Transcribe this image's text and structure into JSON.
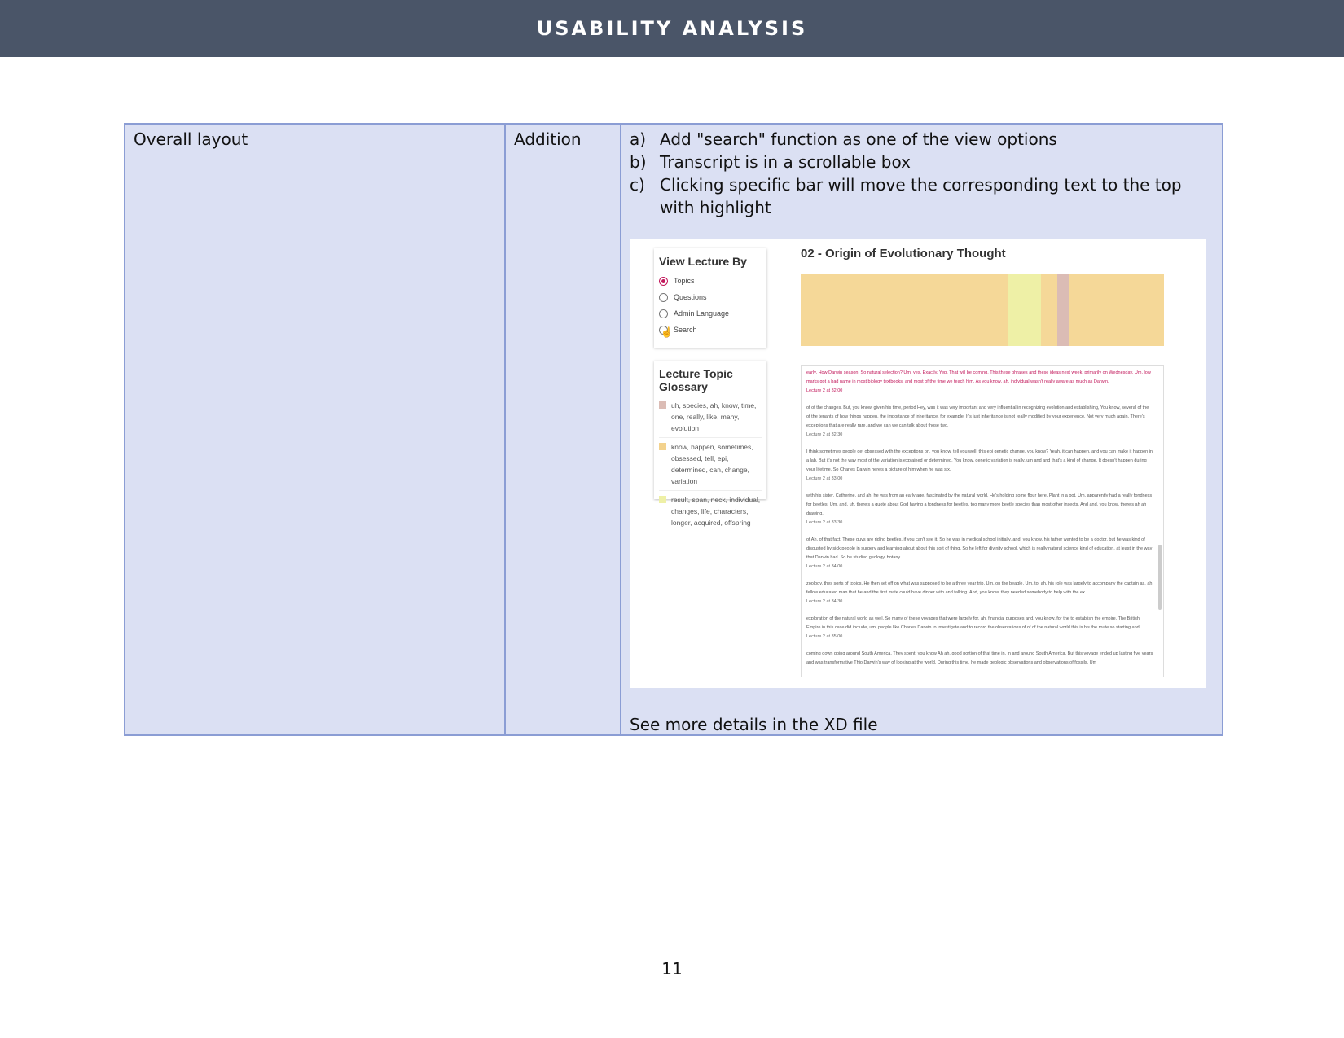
{
  "header": {
    "title": "USABILITY ANALYSIS"
  },
  "table": {
    "col1": "Overall layout",
    "col2": "Addition",
    "notes": [
      {
        "marker": "a)",
        "text": "Add \"search\" function as one of the view options"
      },
      {
        "marker": "b)",
        "text": "Transcript is in a scrollable box"
      },
      {
        "marker": "c)",
        "text": "Clicking specific bar will move the corresponding text to the top with highlight"
      }
    ],
    "see_more": "See more details in the XD file"
  },
  "mockup": {
    "view_by": {
      "title": "View Lecture By",
      "options": [
        "Topics",
        "Questions",
        "Admin Language",
        "Search"
      ],
      "selected": "Topics"
    },
    "glossary": {
      "title": "Lecture Topic Glossary",
      "items": [
        {
          "color": "#dbbcb5",
          "text": "uh, species, ah, know, time, one, really, like, many, evolution"
        },
        {
          "color": "#f3d28d",
          "text": "know, happen, sometimes, obsessed, tell, epi, determined, can, change, variation"
        },
        {
          "color": "#eef0a6",
          "text": "result, span, neck, individual, changes, life, characters, longer, acquired, offspring"
        }
      ]
    },
    "lecture_title": "02 - Origin of Evolutionary Thought",
    "bar_colors": {
      "base": "#f5d898",
      "green": "#eef0a6",
      "pink": "#dbbcb5"
    },
    "transcript": [
      {
        "text": "early. How Darwin season. So natural selection? Um, yes. Exactly. Yep. That will be coming. This these phrases and these ideas next week, primarily on Wednesday. Um, low marks got a bad name in most biology textbooks, and most of the time we teach him. As you know, ah, individual wasn't really aware as much as Darwin.",
        "time": "Lecture 2 at 32:00",
        "highlight": true
      },
      {
        "text": "of of the changes. But, you know, given his time, period Hey, was it was very important and very influential in recognizing evolution and establishing, You know, several of the of the tenants of how things happen, the importance of inheritance, for example. It's just inheritance is not really modified by your experience. Not very much again. There's exceptions that are really rare, and we can we can talk about those two.",
        "time": "Lecture 2 at 32:30",
        "highlight": false
      },
      {
        "text": "I think sometimes people get obsessed with the exceptions on, you know, tell you well, this epi genetic change, you know? Yeah, it can happen, and you can make it happen in a lab. But it's not the way most of the variation is explained or determined. You know, genetic variation is really, um and and that's a kind of change. It doesn't happen during your lifetime. So Charles Darwin here's a picture of him when he was six.",
        "time": "Lecture 2 at 33:00",
        "highlight": false
      },
      {
        "text": "with his sister, Catherine, and ah, he was from an early age, fascinated by the natural world. He's holding some flour here. Plant in a pot. Um, apparently had a really fondness for beetles. Um, and, uh, there's a quote about God having a fondness for beetles, too many more beetle species than most other insects. And and, you know, there's ah ah drawing.",
        "time": "Lecture 2 at 33:30",
        "highlight": false
      },
      {
        "text": "of Ah, of that fact. These guys are riding beetles, if you can't see it. So he was in medical school initially, and, you know, his father wanted to be a doctor, but he was kind of disgusted by sick people in surgery and learning about about this sort of thing. So he left for divinity school, which is really natural science kind of education, at least in the way that Darwin had. So he studied geology, botany.",
        "time": "Lecture 2 at 34:00",
        "highlight": false
      },
      {
        "text": "zoology, thes sorts of topics. He then set off on what was supposed to be a three year trip. Um, on the beagle, Um, to, ah, his role was largely to accompany the captain as, ah, fellow educated man that he and the first mate could have dinner with and talking. And, you know, they needed somebody to help with the ex.",
        "time": "Lecture 2 at 34:30",
        "highlight": false
      },
      {
        "text": "exploration of the natural world as well. So many of these voyages that were largely for, ah, financial purposes and, you know, for the to establish the empire. The British Empire in this case did include, um, people like Charles Darwin to investigate and to record the observations of of of the natural world this is his the route so starting and",
        "time": "Lecture 2 at 35:00",
        "highlight": false
      },
      {
        "text": "coming down going around South America. They spent, you know Ah ah, good portion of that time in, in and around South America. But this voyage ended up lasting five years and was transformative Thio Darwin's way of looking at the world. During this time, he made geologic observations and observations of fossils. Um",
        "time": "",
        "highlight": false
      }
    ]
  },
  "page_number": "11"
}
